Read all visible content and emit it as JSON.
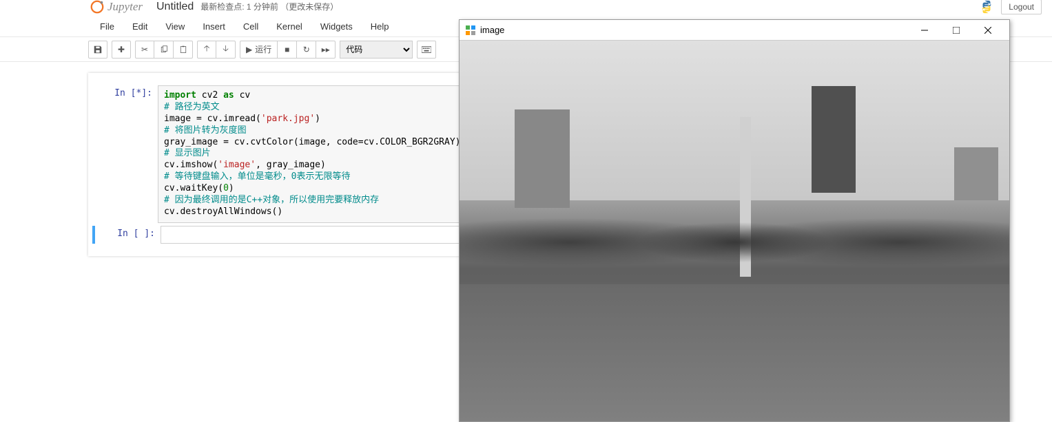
{
  "header": {
    "logo_text": "Jupyter",
    "notebook_name": "Untitled",
    "checkpoint": "最新检查点: 1 分钟前 （更改未保存）",
    "logout": "Logout"
  },
  "menu": {
    "file": "File",
    "edit": "Edit",
    "view": "View",
    "insert": "Insert",
    "cell": "Cell",
    "kernel": "Kernel",
    "widgets": "Widgets",
    "help": "Help"
  },
  "toolbar": {
    "run_label": "运行",
    "cell_type": "代码"
  },
  "cells": [
    {
      "prompt": "In [*]:",
      "code": {
        "l1_import": "import",
        "l1_mod": "cv2",
        "l1_as": "as",
        "l1_alias": "cv",
        "l2": "",
        "l3": "# 路径为英文",
        "l4_a": "image = cv.imread(",
        "l4_str": "'park.jpg'",
        "l4_b": ")",
        "l5": "",
        "l6": "# 将图片转为灰度图",
        "l7": "gray_image = cv.cvtColor(image, code=cv.COLOR_BGR2GRAY)",
        "l8": "",
        "l9": "# 显示图片",
        "l10_a": "cv.imshow(",
        "l10_str": "'image'",
        "l10_b": ", gray_image)",
        "l11": "# 等待键盘输入，单位是毫秒，0表示无限等待",
        "l12_a": "cv.waitKey(",
        "l12_num": "0",
        "l12_b": ")",
        "l13": "# 因为最终调用的是C++对象，所以使用完要释放内存",
        "l14": "cv.destroyAllWindows()"
      }
    },
    {
      "prompt": "In [ ]:"
    }
  ],
  "image_window": {
    "title": "image"
  }
}
